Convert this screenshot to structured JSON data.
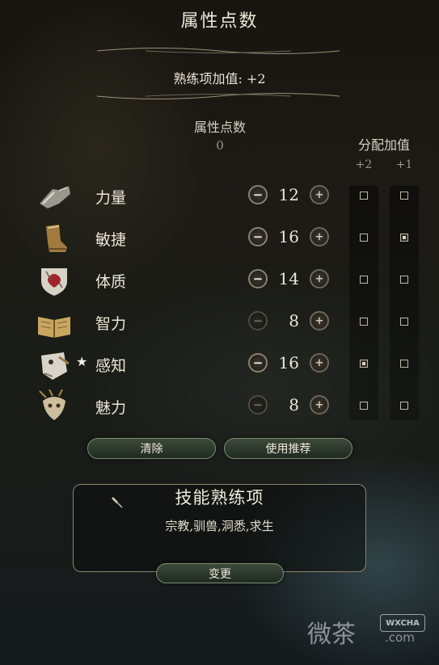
{
  "header": {
    "title": "属性点数",
    "proficiency_label": "熟练项加值: +2"
  },
  "points": {
    "label": "属性点数",
    "value": "0"
  },
  "allocation": {
    "title": "分配加值",
    "col_plus2": "+2",
    "col_plus1": "+1"
  },
  "attributes": [
    {
      "name": "力量",
      "score": "12",
      "icon": "gauntlet-icon",
      "minus_enabled": true,
      "plus2": false,
      "plus1": false,
      "starred": false
    },
    {
      "name": "敏捷",
      "score": "16",
      "icon": "boot-icon",
      "minus_enabled": true,
      "plus2": false,
      "plus1": true,
      "starred": false
    },
    {
      "name": "体质",
      "score": "14",
      "icon": "heart-shield-icon",
      "minus_enabled": true,
      "plus2": false,
      "plus1": false,
      "starred": false
    },
    {
      "name": "智力",
      "score": "8",
      "icon": "open-book-icon",
      "minus_enabled": false,
      "plus2": false,
      "plus1": false,
      "starred": false
    },
    {
      "name": "感知",
      "score": "16",
      "icon": "eye-mask-icon",
      "minus_enabled": true,
      "plus2": true,
      "plus1": false,
      "starred": true
    },
    {
      "name": "魅力",
      "score": "8",
      "icon": "feathered-mask-icon",
      "minus_enabled": false,
      "plus2": false,
      "plus1": false,
      "starred": false
    }
  ],
  "buttons": {
    "clear": "清除",
    "recommend": "使用推荐",
    "change": "变更"
  },
  "skills_panel": {
    "title": "技能熟练项",
    "skills": "宗教,驯兽,洞悉,求生"
  },
  "watermark": {
    "text": "微茶",
    "badge": "WXCHA",
    "domain": ".com"
  }
}
